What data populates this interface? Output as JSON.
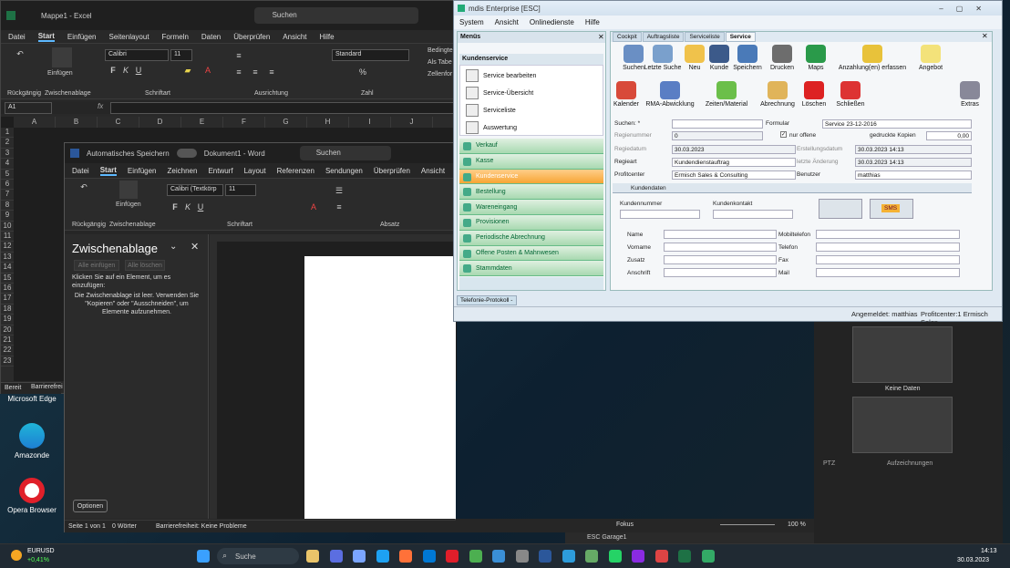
{
  "excel": {
    "title": "Mappe1 - Excel",
    "search": "Suchen",
    "tabs": [
      "Datei",
      "Start",
      "Einfügen",
      "Seitenlayout",
      "Formeln",
      "Daten",
      "Überprüfen",
      "Ansicht",
      "Hilfe"
    ],
    "font": "Calibri",
    "size": "11",
    "numformat": "Standard",
    "groups": [
      "Rückgängig",
      "Zwischenablage",
      "Schriftart",
      "Ausrichtung",
      "Zahl"
    ],
    "paste": "Einfügen",
    "styles": [
      "Bedingte",
      "Als Tabe",
      "Zellenfor"
    ],
    "namebox": "A1",
    "columns": [
      "A",
      "B",
      "C",
      "D",
      "E",
      "F",
      "G",
      "H",
      "I",
      "J"
    ],
    "rows": [
      "1",
      "2",
      "3",
      "4",
      "5",
      "6",
      "7",
      "8",
      "9",
      "10",
      "11",
      "12",
      "13",
      "14",
      "15",
      "16",
      "17",
      "18",
      "19",
      "20",
      "21",
      "22",
      "23"
    ],
    "status": "Bereit",
    "access": "Barrierefrei"
  },
  "word": {
    "autosave": "Automatisches Speichern",
    "title": "Dokument1 - Word",
    "search": "Suchen",
    "tabs": [
      "Datei",
      "Start",
      "Einfügen",
      "Zeichnen",
      "Entwurf",
      "Layout",
      "Referenzen",
      "Sendungen",
      "Überprüfen",
      "Ansicht",
      "Hilfe"
    ],
    "font": "Calibri (Textkörp",
    "size": "11",
    "paste": "Einfügen",
    "groups": [
      "Rückgängig",
      "Zwischenablage",
      "Schriftart",
      "Absatz"
    ],
    "clipboard_title": "Zwischenablage",
    "paste_all": "Alle einfügen",
    "clear_all": "Alle löschen",
    "clip_hint": "Klicken Sie auf ein Element, um es einzufügen:",
    "clip_empty": "Die Zwischenablage ist leer. Verwenden Sie \"Kopieren\" oder \"Ausschneiden\", um Elemente aufzunehmen.",
    "options": "Optionen",
    "page": "Seite 1 von 1",
    "words": "0 Wörter",
    "access": "Barrierefreiheit: Keine Probleme",
    "focus": "Fokus",
    "zoom": "100 %"
  },
  "mdis": {
    "title": "mdis Enterprise [ESC]",
    "menu": [
      "System",
      "Ansicht",
      "Onlinedienste",
      "Hilfe"
    ],
    "menus_label": "Menüs",
    "section": "Kundenservice",
    "tree": [
      "Service bearbeiten",
      "Service-Übersicht",
      "Serviceliste",
      "Auswertung"
    ],
    "nav": [
      "Verkauf",
      "Kasse",
      "Kundenservice",
      "Bestellung",
      "Wareneingang",
      "Provisionen",
      "Periodische Abrechnung",
      "Offene Posten & Mahnwesen",
      "Stammdaten"
    ],
    "nav_selected": 2,
    "tabs": [
      "Cockpit",
      "Auftragsliste",
      "Serviceliste",
      "Service"
    ],
    "tools_row1": [
      "Suchen",
      "Letzte Suche",
      "Neu",
      "Kunde",
      "Speichern",
      "Drucken",
      "Maps",
      "Anzahlung(en) erfassen",
      "Angebot"
    ],
    "tools_row2": [
      "Kalender",
      "RMA-Abwicklung",
      "Zeiten/Material",
      "Abrechnung",
      "Löschen",
      "Schließen",
      "Extras"
    ],
    "form": {
      "suchen": "Suchen: *",
      "regnum_l": "Regienummer",
      "regnum": "0",
      "regdatum_l": "Regiedatum",
      "regdatum": "30.03.2023",
      "regiart_l": "Regieart",
      "regiart": "Kundendienstauftrag",
      "profit_l": "Profitcenter",
      "profit": "Ermisch Sales & Consulting",
      "formular_l": "Formular",
      "formular": "Service 23-12-2016",
      "nur_offene": "nur offene",
      "kopien_l": "gedruckte Kopien",
      "kopien": "0,00",
      "erstell_l": "Erstellungsdatum",
      "erstell": "30.03.2023 14:13",
      "aender_l": "letzte Änderung",
      "aender": "30.03.2023 14:13",
      "benutzer_l": "Benutzer",
      "benutzer": "matthias",
      "kundendaten": "Kundendaten",
      "kundennr": "Kundennummer",
      "kundenkontakt": "Kundenkontakt",
      "sms": "SMS",
      "left_fields": [
        "Name",
        "Vorname",
        "Zusatz",
        "Anschrift"
      ],
      "right_fields": [
        "Mobiltelefon",
        "Telefon",
        "Fax",
        "Mail"
      ]
    },
    "footer_tab": "Telefonie-Protokoll -",
    "logged": "Angemeldet: matthias",
    "center": "Profitcenter:1 Ermisch Sales"
  },
  "cam": {
    "no_data": "Keine Daten",
    "ptz": "PTZ",
    "recordings": "Aufzeichnungen",
    "garage": "ESC Garage1"
  },
  "desktop": {
    "icons": [
      "Microsoft Edge",
      "Amazonde",
      "Opera Browser"
    ]
  },
  "taskbar": {
    "ticker": "EURUSD",
    "change": "+0,41%",
    "search": "Suche",
    "time": "14:13",
    "date": "30.03.2023"
  }
}
